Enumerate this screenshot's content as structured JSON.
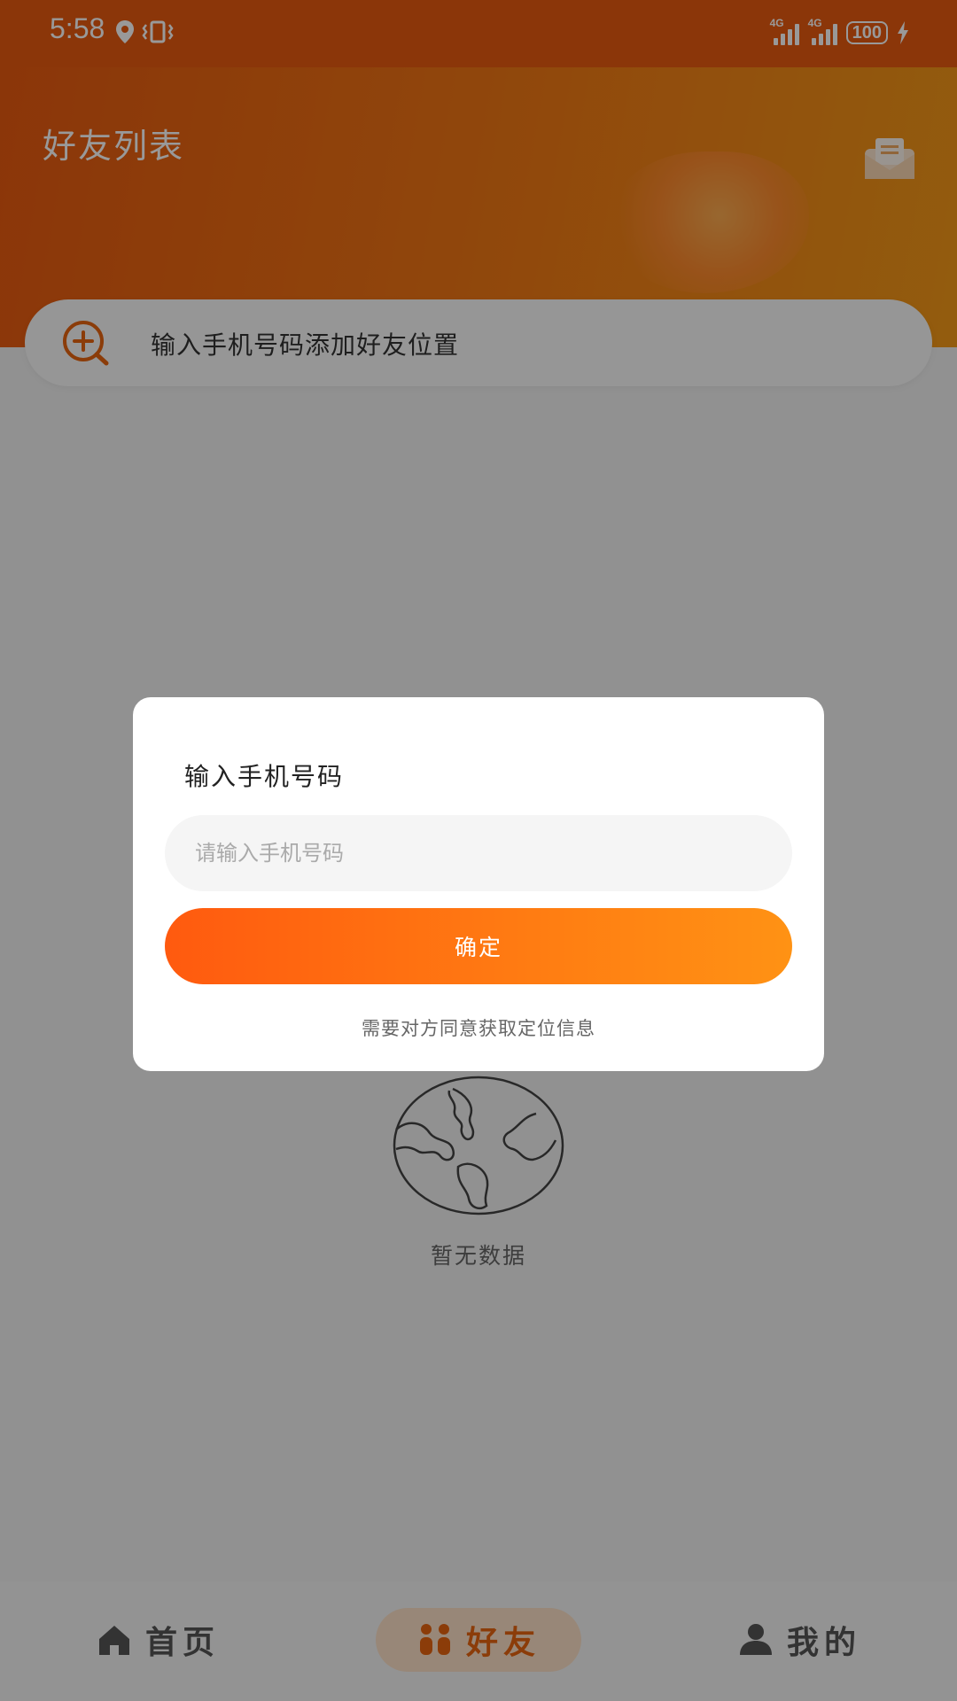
{
  "status_bar": {
    "time": "5:58",
    "network1": "4G",
    "network2": "4G",
    "battery": "100"
  },
  "header": {
    "title": "好友列表"
  },
  "search": {
    "text": "输入手机号码添加好友位置"
  },
  "empty_state": {
    "text": "暂无数据"
  },
  "bottom_nav": {
    "items": [
      {
        "label": "首页",
        "icon": "home-icon"
      },
      {
        "label": "好友",
        "icon": "friends-icon",
        "active": true
      },
      {
        "label": "我的",
        "icon": "person-icon"
      }
    ]
  },
  "dialog": {
    "title": "输入手机号码",
    "input_placeholder": "请输入手机号码",
    "confirm_label": "确定",
    "hint": "需要对方同意获取定位信息"
  },
  "colors": {
    "accent": "#ff6a10",
    "header_start": "#e85a10",
    "header_end": "#f59a18",
    "nav_active_bg": "#fde2c9"
  }
}
